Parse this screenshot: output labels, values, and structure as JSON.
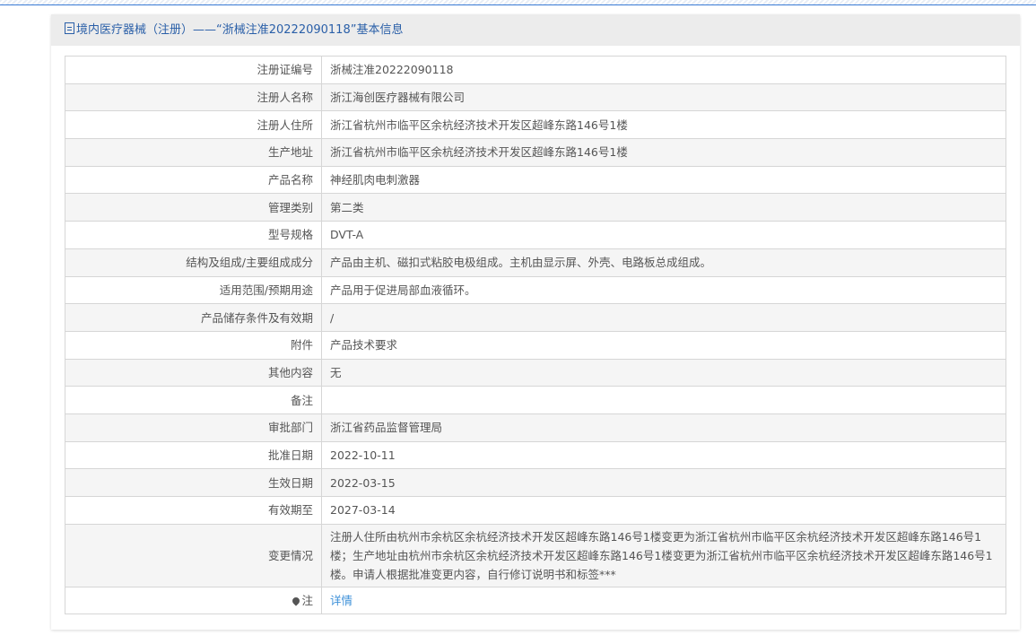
{
  "title": "境内医疗器械（注册）——“浙械注准20222090118”基本信息",
  "rows": [
    {
      "label": "注册证编号",
      "value": "浙械注准20222090118"
    },
    {
      "label": "注册人名称",
      "value": "浙江海创医疗器械有限公司"
    },
    {
      "label": "注册人住所",
      "value": "浙江省杭州市临平区余杭经济技术开发区超峰东路146号1楼"
    },
    {
      "label": "生产地址",
      "value": "浙江省杭州市临平区余杭经济技术开发区超峰东路146号1楼"
    },
    {
      "label": "产品名称",
      "value": "神经肌肉电刺激器"
    },
    {
      "label": "管理类别",
      "value": "第二类"
    },
    {
      "label": "型号规格",
      "value": "DVT-A"
    },
    {
      "label": "结构及组成/主要组成成分",
      "value": "产品由主机、磁扣式粘胶电极组成。主机由显示屏、外壳、电路板总成组成。"
    },
    {
      "label": "适用范围/预期用途",
      "value": "产品用于促进局部血液循环。"
    },
    {
      "label": "产品储存条件及有效期",
      "value": "/"
    },
    {
      "label": "附件",
      "value": "产品技术要求"
    },
    {
      "label": "其他内容",
      "value": "无"
    },
    {
      "label": "备注",
      "value": ""
    },
    {
      "label": "审批部门",
      "value": "浙江省药品监督管理局"
    },
    {
      "label": "批准日期",
      "value": "2022-10-11"
    },
    {
      "label": "生效日期",
      "value": "2022-03-15"
    },
    {
      "label": "有效期至",
      "value": "2027-03-14"
    },
    {
      "label": "变更情况",
      "value": "注册人住所由杭州市余杭区余杭经济技术开发区超峰东路146号1楼变更为浙江省杭州市临平区余杭经济技术开发区超峰东路146号1楼；生产地址由杭州市余杭区余杭经济技术开发区超峰东路146号1楼变更为浙江省杭州市临平区余杭经济技术开发区超峰东路146号1楼。申请人根据批准变更内容，自行修订说明书和标签***"
    }
  ],
  "note": {
    "label": "注",
    "link": "详情"
  }
}
